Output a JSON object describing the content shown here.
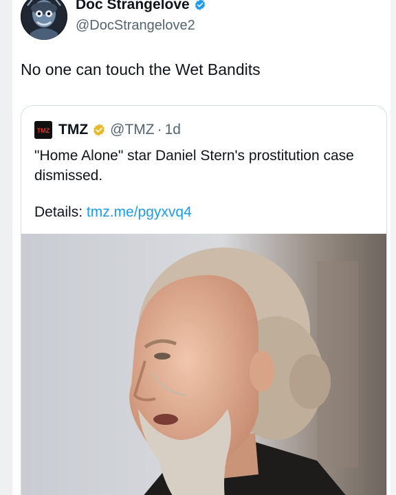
{
  "author": {
    "display_name": "Doc Strangelove",
    "handle": "@DocStrangelove2",
    "verified_color": "#1d9bf0"
  },
  "tweet": {
    "text": "No one can touch the Wet Bandits"
  },
  "quoted": {
    "logo_text": "TMZ",
    "name": "TMZ",
    "handle": "@TMZ",
    "separator": "·",
    "time": "1d",
    "badge_color": "#e8b829",
    "body": "\"Home Alone\" star Daniel Stern's prostitution case dismissed.",
    "details_label": "Details:",
    "details_link": "tmz.me/pgyxvq4",
    "link_color": "#1d9bf0"
  },
  "icons": {
    "avatar": "avatar-icon",
    "verified": "verified-badge-icon",
    "gold": "gold-verified-badge-icon",
    "tmz_logo": "tmz-logo-icon",
    "photo": "portrait-photo"
  }
}
